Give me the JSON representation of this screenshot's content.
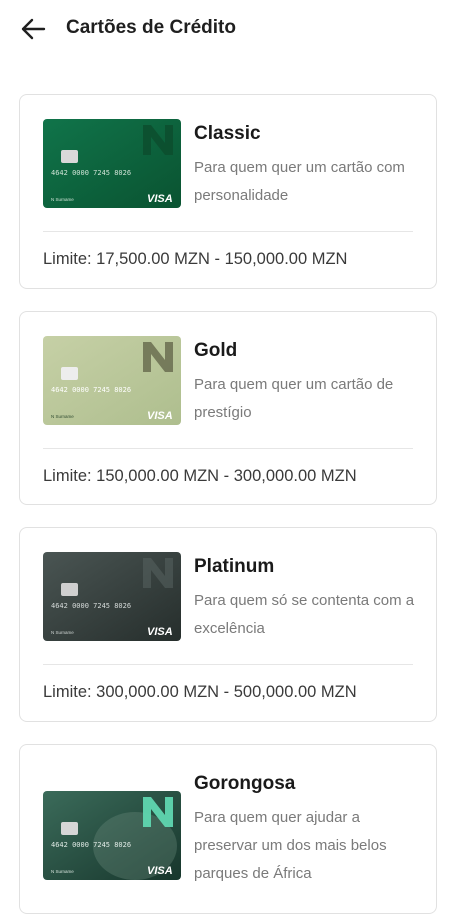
{
  "header": {
    "title": "Cartões de Crédito",
    "back_icon": "arrow-left-icon"
  },
  "cards": [
    {
      "name": "Classic",
      "description": "Para quem quer um cartão com personalidade",
      "limit": "Limite: 17,500.00 MZN - 150,000.00 MZN",
      "card_number": "4642 0000 7245 8026",
      "card_brand": "VISA",
      "holder": "N Surname",
      "bank_label": "Nedbank",
      "color_top": "#0e6a3c",
      "color_bottom": "#0b5a33"
    },
    {
      "name": "Gold",
      "description": "Para quem quer um cartão de prestígio",
      "limit": "Limite: 150,000.00 MZN - 300,000.00 MZN",
      "card_number": "4642 0000 7245 8026",
      "card_brand": "VISA",
      "holder": "N Surname",
      "bank_label": "Nedbank",
      "color_top": "#b9c79a",
      "color_bottom": "#c8d3a8"
    },
    {
      "name": "Platinum",
      "description": "Para quem só se contenta com a excelência",
      "limit": "Limite: 300,000.00 MZN - 500,000.00 MZN",
      "card_number": "4642 0000 7245 8026",
      "card_brand": "VISA",
      "holder": "N Surname",
      "bank_label": "Nedbank",
      "color_top": "#3e4a47",
      "color_bottom": "#2b3331"
    },
    {
      "name": "Gorongosa",
      "description": "Para quem quer ajudar a preservar um dos mais belos parques de África",
      "limit": "",
      "card_number": "4642 0000 7245 8026",
      "card_brand": "VISA",
      "holder": "N Surname",
      "bank_label": "Nedbank",
      "color_top": "#2d5a4a",
      "color_bottom": "#1d3f34"
    }
  ]
}
